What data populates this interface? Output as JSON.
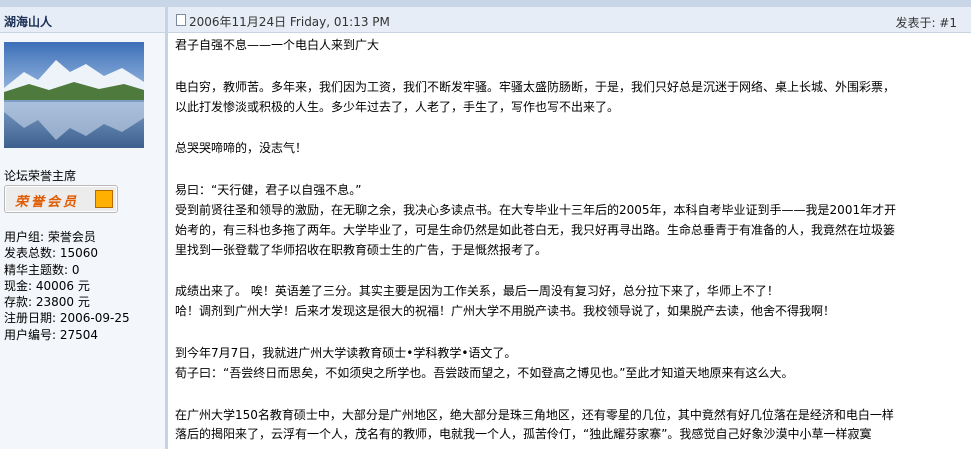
{
  "author": {
    "name": "湖海山人",
    "rank_title": "论坛荣誉主席",
    "rank_badge": "荣誉会员",
    "stats": [
      "用户组: 荣誉会员",
      "发表总数: 15060",
      "精华主题数: 0",
      "现金: 40006 元",
      "存款: 23800 元",
      "注册日期: 2006-09-25",
      "用户编号: 27504"
    ]
  },
  "post": {
    "date": "2006年11月24日 Friday, 01:13 PM",
    "floor": "发表于: #1",
    "paragraphs": [
      [
        "君子自强不息——一个电白人来到广大"
      ],
      [
        "电白穷，教师苦。多年来，我们因为工资，我们不断发牢骚。牢骚太盛防肠断，于是，我们只好总是沉迷于网络、桌上长城、外围彩票，",
        "以此打发惨淡或积极的人生。多少年过去了，人老了，手生了，写作也写不出来了。"
      ],
      [
        "总哭哭啼啼的，没志气！"
      ],
      [
        "易曰：“天行健，君子以自强不息。”",
        "受到前贤往圣和领导的激励，在无聊之余，我决心多读点书。在大专毕业十三年后的2005年，本科自考毕业证到手——我是2001年才开",
        "始考的，有三科也多拖了两年。大学毕业了，可是生命仍然是如此苍白无，我只好再寻出路。生命总垂青于有准备的人，我竟然在垃圾篓",
        "里找到一张登载了华师招收在职教育硕士生的广告，于是慨然报考了。"
      ],
      [
        "成绩出来了。 唉！英语差了三分。其实主要是因为工作关系，最后一周没有复习好，总分拉下来了，华师上不了！",
        "哈！调剂到广州大学！后来才发现这是很大的祝福！广州大学不用脱产读书。我校领导说了，如果脱产去读，他舍不得我啊！"
      ],
      [
        "到今年7月7日，我就进广州大学读教育硕士•学科教学•语文了。",
        "荀子曰：“吾尝终日而思矣，不如须臾之所学也。吾尝跂而望之，不如登高之博见也。”至此才知道天地原来有这么大。"
      ],
      [
        "在广州大学150名教育硕士中，大部分是广州地区，绝大部分是珠三角地区，还有零星的几位，其中竟然有好几位落在是经济和电白一样",
        "落后的揭阳来了，云浮有一个人，茂名有的教师，电就我一个人，孤苦伶仃，“独此耀芬家寨”。我感觉自己好象沙漠中小草一样寂寞"
      ]
    ]
  }
}
